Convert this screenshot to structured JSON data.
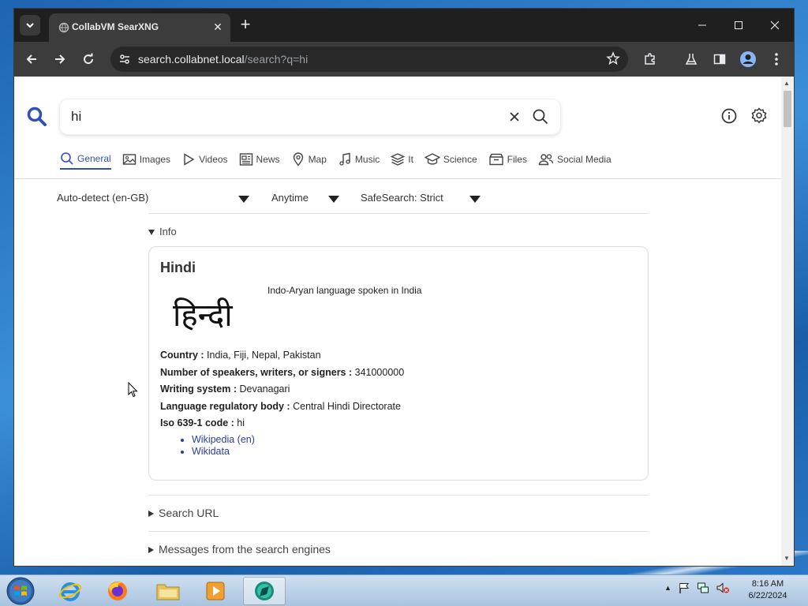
{
  "browser": {
    "tab_title": "CollabVM SearXNG",
    "url_host": "search.collabnet.local",
    "url_path": "/search?q=hi"
  },
  "search": {
    "query": "hi",
    "categories": [
      "General",
      "Images",
      "Videos",
      "News",
      "Map",
      "Music",
      "It",
      "Science",
      "Files",
      "Social Media"
    ],
    "active_category": "General",
    "filters": {
      "language": "Auto-detect (en-GB)",
      "time": "Anytime",
      "safesearch": "SafeSearch: Strict"
    }
  },
  "infobox": {
    "toggle_label": "Info",
    "title": "Hindi",
    "image_text": "हिन्दी",
    "description": "Indo-Aryan language spoken in India",
    "attributes": [
      {
        "label": "Country :",
        "value": "India, Fiji, Nepal, Pakistan"
      },
      {
        "label": "Number of speakers, writers, or signers :",
        "value": "341000000"
      },
      {
        "label": "Writing system :",
        "value": "Devanagari"
      },
      {
        "label": "Language regulatory body :",
        "value": "Central Hindi Directorate"
      },
      {
        "label": "Iso 639-1 code :",
        "value": "hi"
      }
    ],
    "links": [
      "Wikipedia (en)",
      "Wikidata"
    ]
  },
  "sections": {
    "search_url": "Search URL",
    "engine_messages": "Messages from the search engines"
  },
  "taskbar": {
    "time": "8:16 AM",
    "date": "6/22/2024"
  },
  "colors": {
    "accent": "#3050b4",
    "link": "#2a3e9c"
  }
}
